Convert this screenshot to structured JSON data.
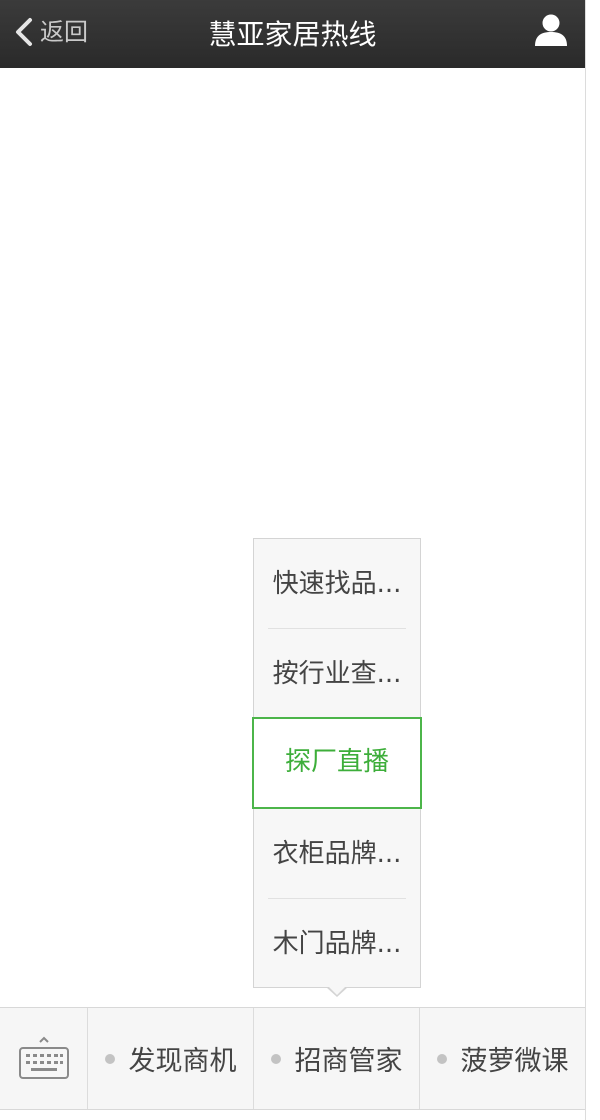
{
  "header": {
    "back_label": "返回",
    "title": "慧亚家居热线",
    "back_icon": "chevron-left-icon",
    "user_icon": "user-icon"
  },
  "popup_menu": {
    "items": [
      {
        "label": "快速找品..."
      },
      {
        "label": "按行业查..."
      },
      {
        "label": "探厂直播",
        "selected": true
      },
      {
        "label": "衣柜品牌..."
      },
      {
        "label": "木门品牌..."
      }
    ]
  },
  "bottom_bar": {
    "keyboard_icon": "keyboard-icon",
    "menus": [
      {
        "label": "发现商机"
      },
      {
        "label": "招商管家",
        "expanded": true
      },
      {
        "label": "菠萝微课"
      }
    ]
  },
  "colors": {
    "header_bg": "#2f2f2f",
    "active_green": "#3dae3a"
  }
}
